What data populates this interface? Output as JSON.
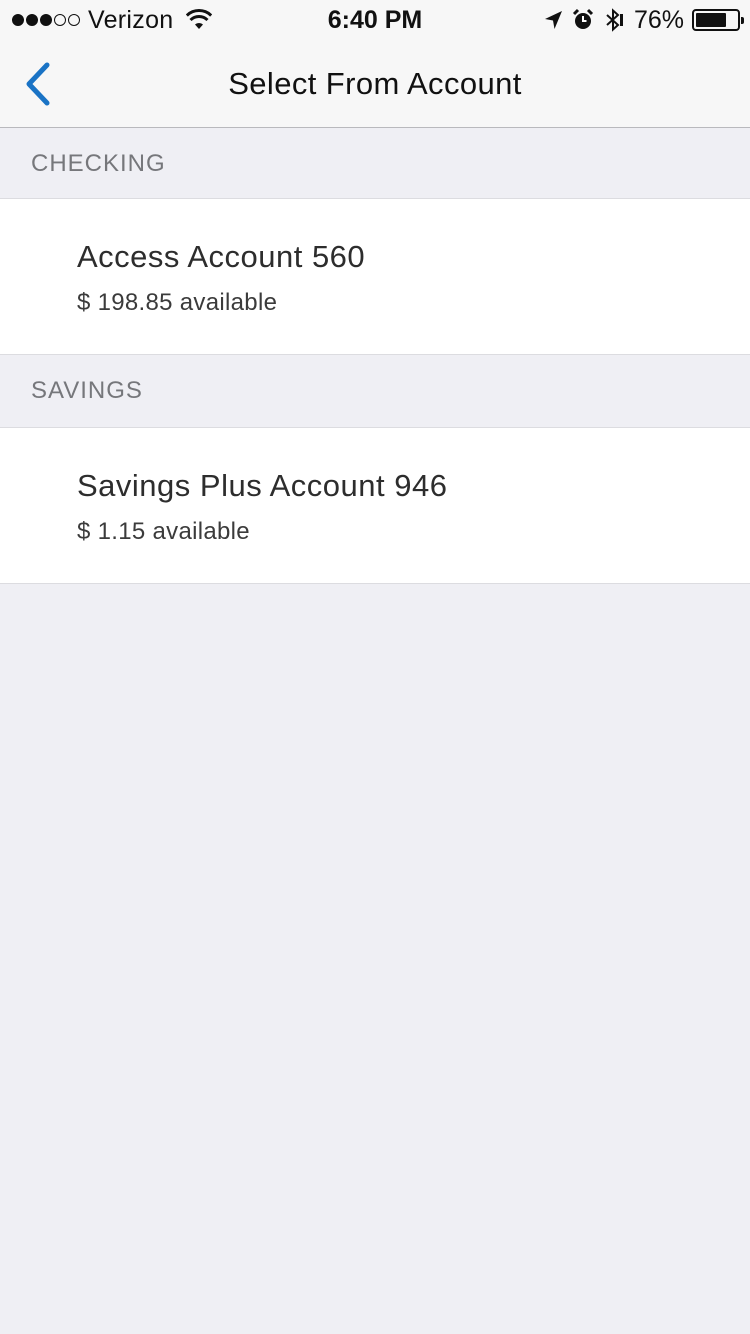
{
  "status_bar": {
    "carrier": "Verizon",
    "signal_bars_filled": 3,
    "signal_bars_total": 5,
    "time": "6:40 PM",
    "battery_percent": "76%",
    "battery_level": 0.76,
    "icons": [
      "wifi-icon",
      "location-arrow-icon",
      "alarm-icon",
      "bluetooth-icon",
      "battery-icon"
    ]
  },
  "nav": {
    "title": "Select From Account",
    "back_icon": "chevron-left-icon",
    "accent_color": "#1a73c5"
  },
  "sections": [
    {
      "header": "CHECKING",
      "accounts": [
        {
          "name": "Access Account 560",
          "balance": "$ 198.85 available"
        }
      ]
    },
    {
      "header": "SAVINGS",
      "accounts": [
        {
          "name": "Savings Plus Account 946",
          "balance": "$ 1.15 available"
        }
      ]
    }
  ]
}
